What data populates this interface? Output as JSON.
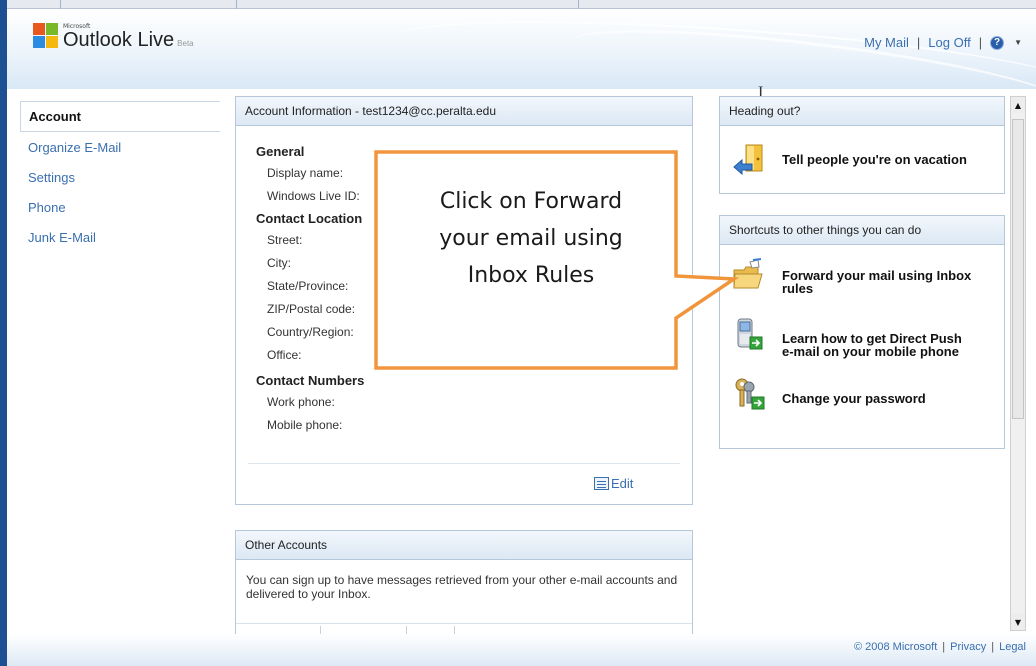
{
  "header": {
    "logo_microsoft": "Microsoft",
    "logo_title": "Outlook Live",
    "logo_beta": "Beta",
    "links": {
      "my_mail": "My Mail",
      "log_off": "Log Off",
      "separator": "|",
      "help": "?"
    }
  },
  "nav": {
    "items": [
      {
        "label": "Account",
        "active": true
      },
      {
        "label": "Organize E-Mail",
        "active": false
      },
      {
        "label": "Settings",
        "active": false
      },
      {
        "label": "Phone",
        "active": false
      },
      {
        "label": "Junk E-Mail",
        "active": false
      }
    ]
  },
  "account": {
    "title": "Account Information - test1234@cc.peralta.edu",
    "sections": [
      {
        "title": "General",
        "fields": [
          "Display name:",
          "Windows Live ID:"
        ]
      },
      {
        "title": "Contact Location",
        "fields": [
          "Street:",
          "City:",
          "State/Province:",
          "ZIP/Postal code:",
          "Country/Region:",
          "Office:"
        ]
      },
      {
        "title": "Contact Numbers",
        "fields": [
          "Work phone:",
          "Mobile phone:"
        ]
      }
    ],
    "edit_label": "Edit"
  },
  "other_accounts": {
    "title": "Other Accounts",
    "description": "You can sign up to have messages retrieved from your other e-mail accounts and delivered to your Inbox."
  },
  "heading_out": {
    "title": "Heading out?",
    "link": "Tell people you're on vacation"
  },
  "shortcuts": {
    "title": "Shortcuts to other things you can do",
    "links": [
      {
        "line1": "Forward your mail using Inbox",
        "line2": "rules",
        "icon": "folder-forward-icon"
      },
      {
        "line1": "Learn how to get Direct Push",
        "line2": "e-mail on your mobile phone",
        "icon": "mobile-phone-icon"
      },
      {
        "line1": "Change your password",
        "line2": "",
        "icon": "keys-icon"
      }
    ]
  },
  "callout": {
    "lines": [
      "Click on Forward",
      "your email using",
      "Inbox Rules"
    ],
    "border_color": "#f0953c"
  },
  "footer": {
    "copyright": "© 2008 Microsoft",
    "privacy": "Privacy",
    "legal": "Legal",
    "separator": "|"
  },
  "colors": {
    "link": "#3a6fb0",
    "frame": "#1d4f93",
    "panel_border": "#b7c7da"
  }
}
